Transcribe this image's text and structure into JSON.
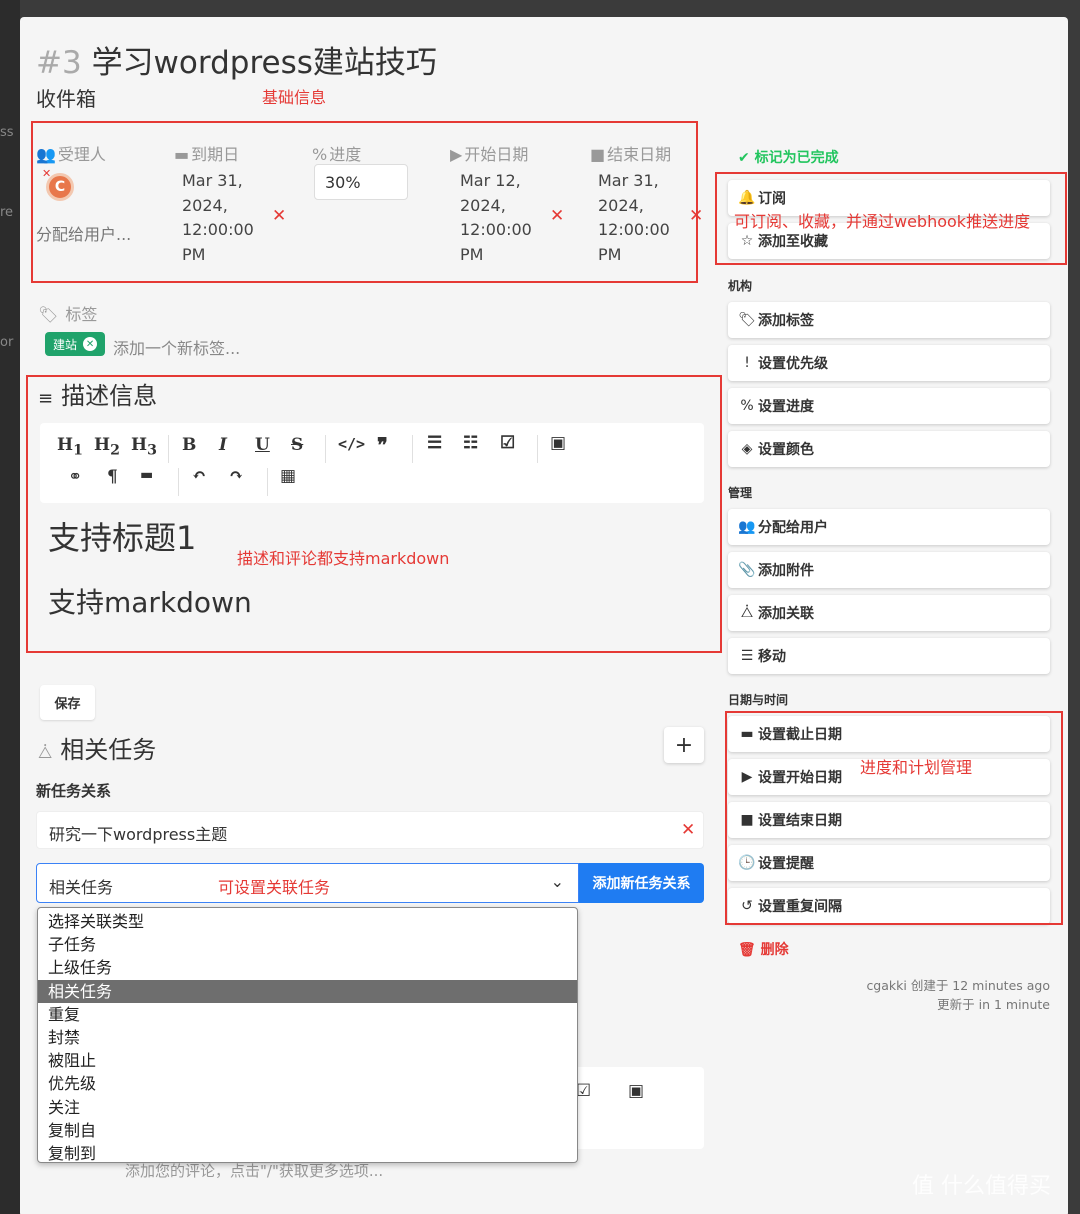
{
  "task": {
    "number": "#3",
    "title": "学习wordpress建站技巧",
    "project": "收件箱"
  },
  "attributes": {
    "assignees_label": "受理人",
    "assignees_placeholder": "分配给用户...",
    "avatar_initial": "C",
    "due_date_label": "到期日",
    "due_date_lines": [
      "Mar 31,",
      "2024,",
      "12:00:00",
      "PM"
    ],
    "progress_label": "进度",
    "progress_value": "30%",
    "start_date_label": "开始日期",
    "start_date_lines": [
      "Mar 12,",
      "2024,",
      "12:00:00",
      "PM"
    ],
    "end_date_label": "结束日期",
    "end_date_lines": [
      "Mar 31,",
      "2024,",
      "12:00:00",
      "PM"
    ]
  },
  "labels": {
    "heading": "标签",
    "tag": "建站",
    "add_placeholder": "添加一个新标签..."
  },
  "description": {
    "heading": "描述信息",
    "heading1": "支持标题1",
    "paragraph": "支持markdown",
    "save": "保存"
  },
  "related": {
    "heading": "相关任务",
    "new_relation_label": "新任务关系",
    "task_input_value": "研究一下wordpress主题",
    "relation_select_value": "相关任务",
    "add_button": "添加新任务关系",
    "options": [
      "选择关联类型",
      "子任务",
      "上级任务",
      "相关任务",
      "重复",
      "封禁",
      "被阻止",
      "优先级",
      "关注",
      "复制自",
      "复制到"
    ],
    "selected_option": "相关任务",
    "comment_placeholder": "添加您的评论，点击\"/\"获取更多选项..."
  },
  "sidebar": {
    "mark_done": "标记为已完成",
    "subscribe": "订阅",
    "favorite": "添加至收藏",
    "section_org": "机构",
    "org_items": [
      "添加标签",
      "设置优先级",
      "设置进度",
      "设置颜色"
    ],
    "section_manage": "管理",
    "manage_items": [
      "分配给用户",
      "添加附件",
      "添加关联",
      "移动"
    ],
    "section_datetime": "日期与时间",
    "date_items": [
      "设置截止日期",
      "设置开始日期",
      "设置结束日期",
      "设置提醒",
      "设置重复间隔"
    ],
    "delete": "删除",
    "created": "cgakki 创建于 12 minutes ago",
    "updated": "更新于 in 1 minute"
  },
  "annotations": {
    "basic_info": "基础信息",
    "subscribe_note": "可订阅、收藏，并通过webhook推送进度",
    "markdown_note": "描述和评论都支持markdown",
    "plan_note": "进度和计划管理",
    "relation_note": "可设置关联任务"
  },
  "watermark": "值 什么值得买",
  "colors": {
    "accent_blue": "#1f7cf2",
    "done_green": "#22c55e",
    "tag_green": "#20a36b",
    "annotation_red": "#e53935",
    "delete_red": "#e53935"
  }
}
